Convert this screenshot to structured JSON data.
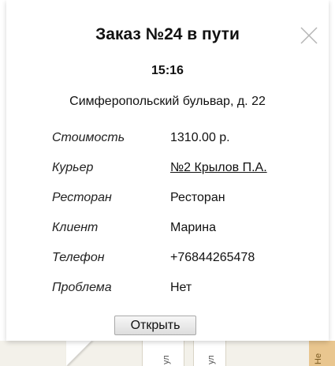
{
  "balloon": {
    "title": "Заказ №24 в пути",
    "time": "15:16",
    "address": "Симферопольский бульвар, д. 22",
    "close_icon": "close-icon",
    "rows": [
      {
        "label": "Стоимость",
        "value": "1310.00 р."
      },
      {
        "label": "Курьер",
        "value": "№2 Крылов П.А.",
        "link": true
      },
      {
        "label": "Ресторан",
        "value": "Ресторан"
      },
      {
        "label": "Клиент",
        "value": "Марина"
      },
      {
        "label": "Телефон",
        "value": "+76844265478"
      },
      {
        "label": "Проблема",
        "value": "Нет"
      }
    ],
    "open_button": "Открыть"
  },
  "map": {
    "labels": [
      "ул",
      "ул",
      "Не"
    ]
  }
}
